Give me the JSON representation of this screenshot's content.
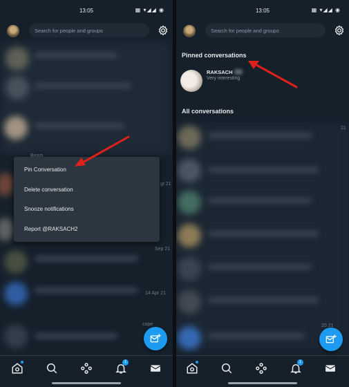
{
  "left": {
    "time": "13:05",
    "search_placeholder": "Search for people and groups",
    "context_menu": {
      "items": [
        "Pin Conversation",
        "Delete conversation",
        "Snooze notifications",
        "Report @RAKSACH2"
      ]
    },
    "ghost_texts": [
      "Beam",
      "gt 21",
      "Sep 21",
      "14 Apr 21",
      "cope"
    ],
    "nav_badge": "1"
  },
  "right": {
    "time": "13:05",
    "search_placeholder": "Search for people and groups",
    "pinned_title": "Pinned conversations",
    "pinned": {
      "name": "RAKSACH",
      "message": "Very interesting"
    },
    "all_title": "All conversations",
    "ghost_texts": [
      "21",
      "20 21",
      "21"
    ],
    "nav_badge": "1"
  },
  "colors": {
    "background": "#15202b",
    "accent": "#1d9bf0",
    "menu": "#2b3640",
    "arrow": "#e0201b"
  },
  "icons": [
    "settings-icon",
    "home-icon",
    "search-icon",
    "spaces-icon",
    "notifications-icon",
    "messages-icon",
    "compose-message-icon",
    "arrow-annotation"
  ]
}
